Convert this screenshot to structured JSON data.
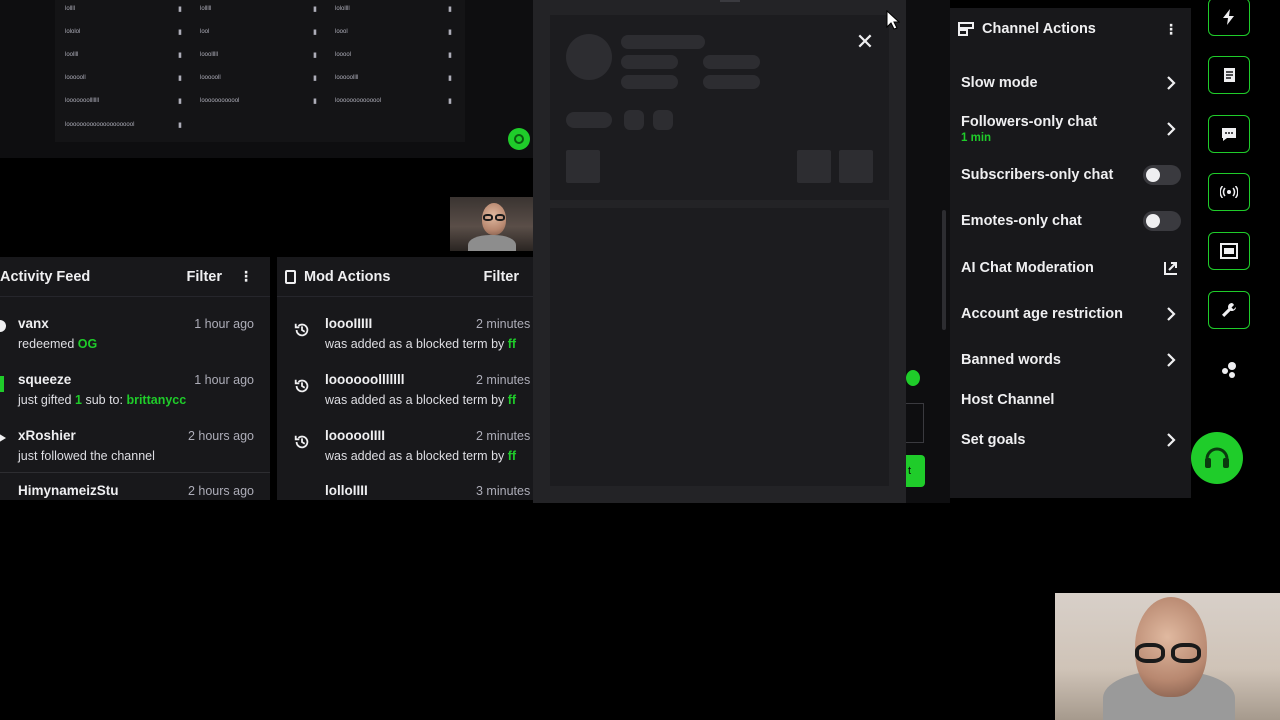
{
  "blocked_terms_grid": {
    "rows": [
      [
        "lollll",
        "lolllll",
        "lolollll"
      ],
      [
        "lololol",
        "lool",
        "loool"
      ],
      [
        "loollll",
        "looolllll",
        "looool"
      ],
      [
        "loooooll",
        "loooooll",
        "looooollll"
      ],
      [
        "looooooolllllll",
        "loooooooooool",
        "loooooooooooool"
      ],
      [
        "looooooooooooooooooool",
        "",
        ""
      ]
    ]
  },
  "activity_feed": {
    "title": "Activity Feed",
    "filter_label": "Filter",
    "items": [
      {
        "name": "vanx",
        "action": "redeemed",
        "highlight": "OG",
        "time": "1 hour ago"
      },
      {
        "name": "squeeze",
        "action_prefix": "just gifted",
        "count": "1",
        "action_mid": "sub to:",
        "highlight": "brittanycc",
        "time": "1 hour ago"
      },
      {
        "name": "xRoshier",
        "action": "just followed the channel",
        "time": "2 hours ago"
      },
      {
        "name": "HimynameizStu",
        "time": "2 hours ago"
      }
    ]
  },
  "mod_actions": {
    "title": "Mod Actions",
    "filter_label": "Filter",
    "items": [
      {
        "term": "loooIIIII",
        "action": "was added as a blocked term by",
        "by": "ff",
        "time": "2 minutes"
      },
      {
        "term": "loooooolllllll",
        "action": "was added as a blocked term by",
        "by": "ff",
        "time": "2 minutes"
      },
      {
        "term": "loooooIIII",
        "action": "was added as a blocked term by",
        "by": "ff",
        "time": "2 minutes"
      },
      {
        "term": "lolloIIII",
        "time": "3 minutes"
      }
    ]
  },
  "overlay": {
    "close_icon": "close-icon",
    "behind_send_text": "t"
  },
  "channel_actions": {
    "title": "Channel Actions",
    "items": [
      {
        "label": "Slow mode"
      },
      {
        "label": "Followers-only chat",
        "sub": "1 min"
      },
      {
        "label": "Subscribers-only chat",
        "toggle": false
      },
      {
        "label": "Emotes-only chat",
        "toggle": false
      },
      {
        "label": "AI Chat Moderation"
      },
      {
        "label": "Account age restriction"
      },
      {
        "label": "Banned words"
      },
      {
        "label": "Host Channel"
      },
      {
        "label": "Set goals"
      }
    ]
  },
  "right_rail": {
    "buttons": [
      "lightning-icon",
      "notes-icon",
      "chat-icon",
      "broadcast-icon",
      "layout-icon",
      "wrench-icon",
      "dots-icon",
      "headset-icon"
    ]
  },
  "colors": {
    "accent": "#1fcc2a",
    "panel": "#18181b",
    "background": "#000000"
  }
}
